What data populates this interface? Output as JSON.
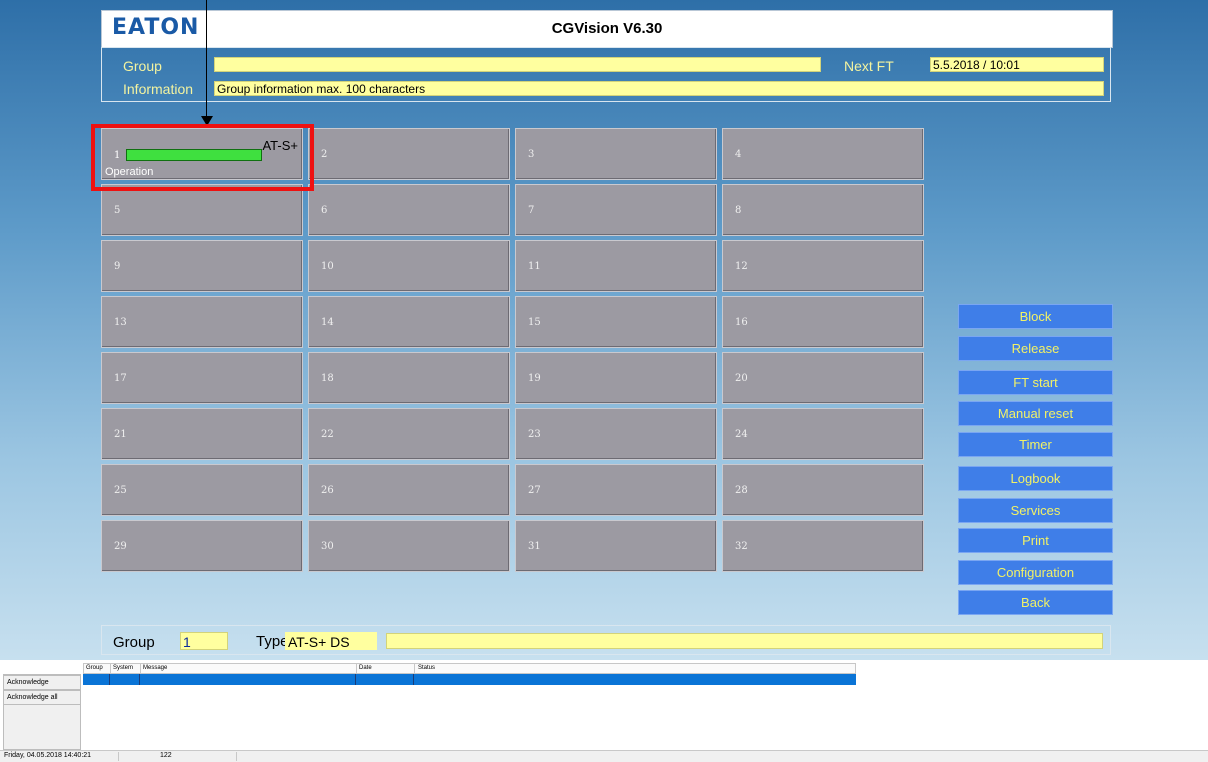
{
  "header": {
    "logo": "EATON",
    "title": "CGVision V6.30"
  },
  "info": {
    "group_label": "Group",
    "group_value": "",
    "next_ft_label": "Next FT",
    "next_ft_value": "5.5.2018 / 10:01",
    "information_label": "Information",
    "information_value": "Group information max. 100 characters"
  },
  "grid": {
    "cell1": {
      "number": "1",
      "type": "AT-S+",
      "status": "Operation"
    },
    "cells": [
      "2",
      "3",
      "4",
      "5",
      "6",
      "7",
      "8",
      "9",
      "10",
      "11",
      "12",
      "13",
      "14",
      "15",
      "16",
      "17",
      "18",
      "19",
      "20",
      "21",
      "22",
      "23",
      "24",
      "25",
      "26",
      "27",
      "28",
      "29",
      "30",
      "31",
      "32"
    ]
  },
  "side_buttons": [
    "Block",
    "Release",
    "FT start",
    "Manual reset",
    "Timer",
    "Logbook",
    "Services",
    "Print",
    "Configuration",
    "Back"
  ],
  "footer": {
    "group_label": "Group",
    "group_value": "1",
    "type_label": "Type",
    "type_value": "AT-S+ DS",
    "info_value": ""
  },
  "alarm": {
    "acknowledge": "Acknowledge",
    "acknowledge_all": "Acknowledge all",
    "columns": [
      "Group",
      "System",
      "Message",
      "Date",
      "Status"
    ]
  },
  "statusbar": {
    "datetime": "Friday, 04.05.2018 14:40:21",
    "count": "122"
  },
  "colors": {
    "background_top": "#2e6fa8",
    "field_yellow": "#ffff9f",
    "button_blue": "#3f7ee8",
    "button_text": "#f2f266",
    "cell_grey": "#9c9aa2",
    "progress_green": "#3fe03f",
    "highlight_red": "#ee1111",
    "selected_row": "#0a74d6"
  }
}
